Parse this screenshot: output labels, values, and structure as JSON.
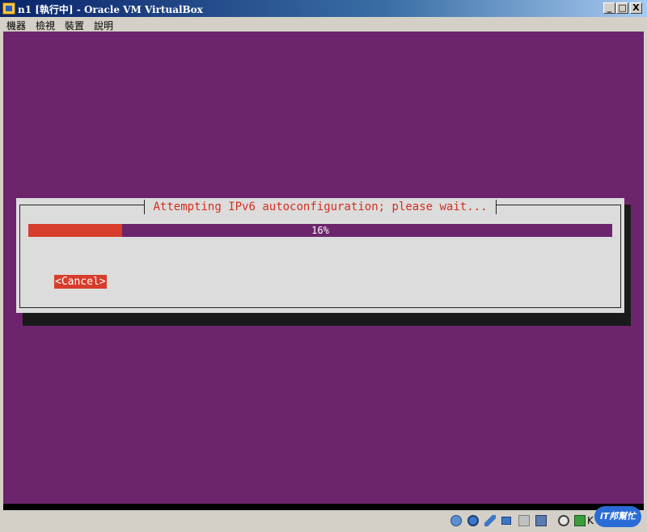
{
  "window": {
    "title": "n1 [執行中] - Oracle VM VirtualBox",
    "buttons": {
      "minimize": "_",
      "maximize": "□",
      "close": "X"
    }
  },
  "menubar": {
    "items": [
      {
        "label": "機器"
      },
      {
        "label": "檢視"
      },
      {
        "label": "裝置"
      },
      {
        "label": "說明"
      }
    ]
  },
  "vm_screen": {
    "background_color": "#6c256c",
    "dialog": {
      "title": "Attempting IPv6 autoconfiguration; please wait...",
      "progress": {
        "fraction": 0.16,
        "label": "16%"
      },
      "cancel_label": "<Cancel>",
      "accent_color": "#d83c2c"
    }
  },
  "statusbar": {
    "icons": [
      "hard-disk-icon",
      "optical-drive-icon",
      "pen-icon",
      "network-icon",
      "shared-folder-icon",
      "display-icon",
      "capture-icon",
      "arrow-down-icon"
    ],
    "partial_text": "K",
    "watermark_text": "iT邦幫忙"
  }
}
